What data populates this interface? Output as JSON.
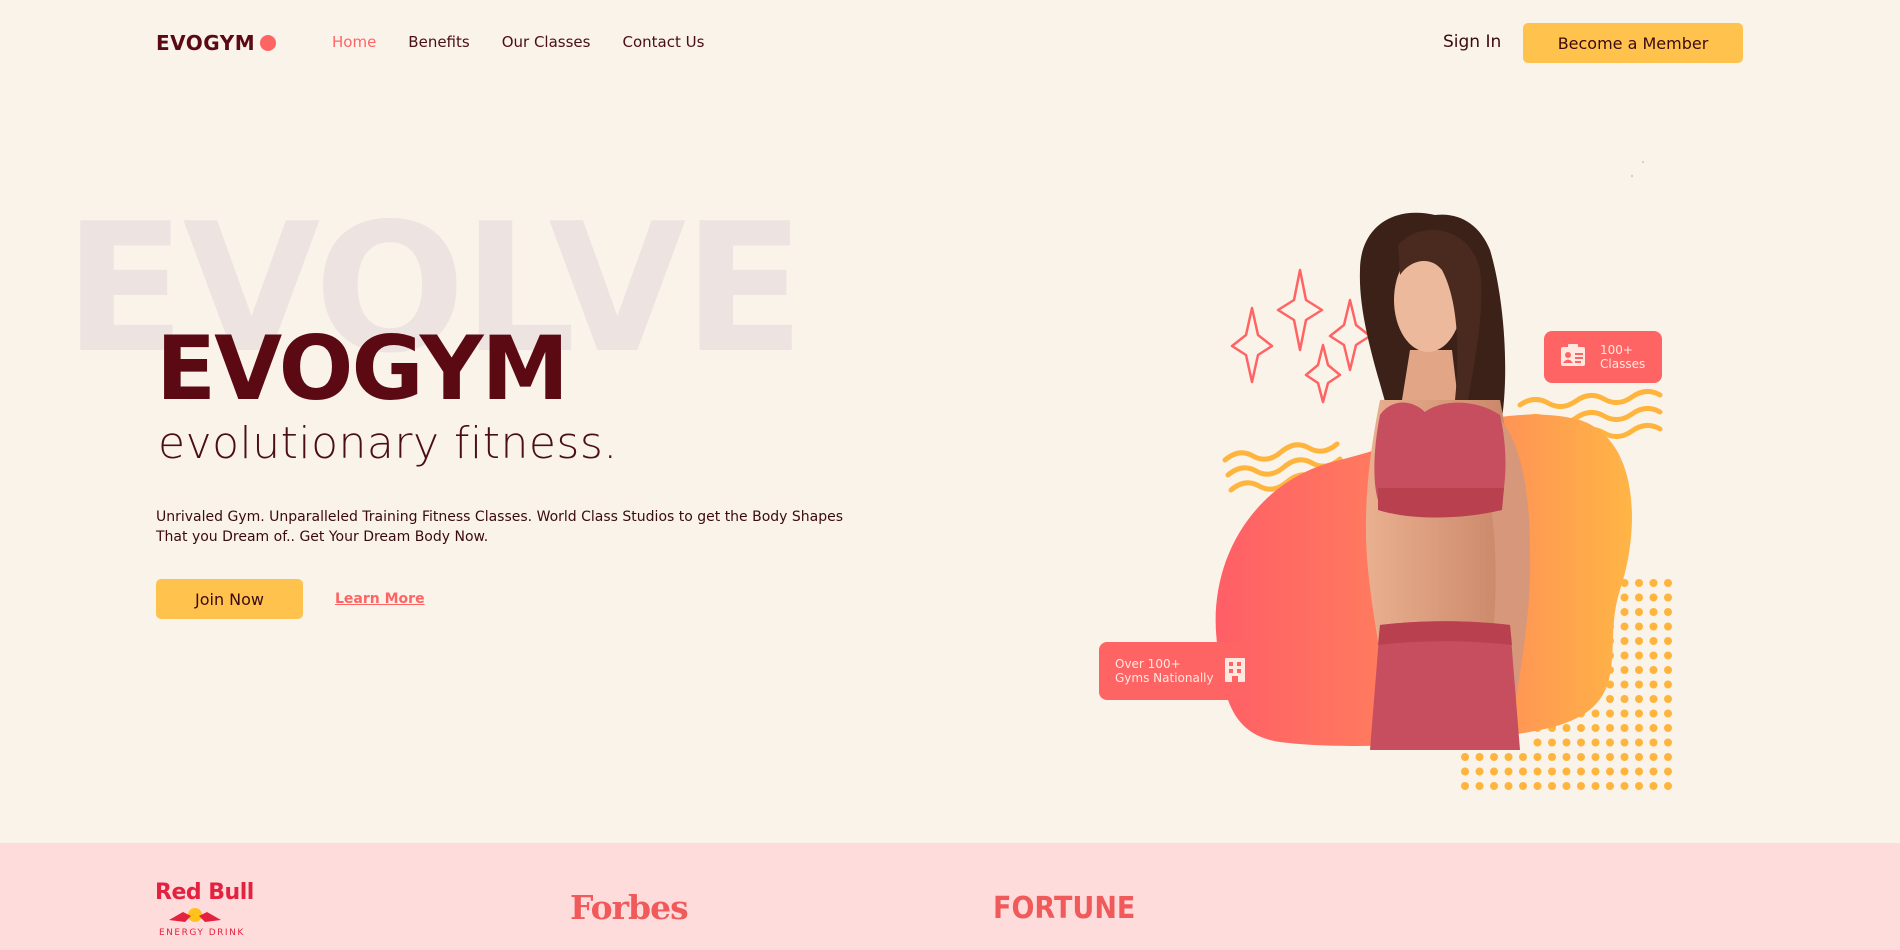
{
  "nav": {
    "logo": "EVOGYM",
    "links": [
      "Home",
      "Benefits",
      "Our Classes",
      "Contact Us"
    ],
    "active_link": "Home",
    "sign_in": "Sign In",
    "member_button": "Become a Member"
  },
  "hero": {
    "background_word": "EVOLVE",
    "title": "EVOGYM",
    "subtitle": "evolutionary fitness.",
    "description": "Unrivaled Gym. Unparalleled Training Fitness Classes. World Class Studios to get the Body Shapes That you Dream of.. Get Your Dream Body Now.",
    "join_button": "Join Now",
    "learn_more": "Learn More",
    "badges": {
      "classes_line1": "100+",
      "classes_line2": "Classes",
      "gyms_line1": "Over 100+",
      "gyms_line2": "Gyms Nationally"
    }
  },
  "sponsors": {
    "redbull": "Red Bull",
    "redbull_sub": "ENERGY DRINK",
    "forbes": "Forbes",
    "fortune": "FORTUNE"
  },
  "colors": {
    "background": "#FAF3EA",
    "primary_dark": "#5B0A13",
    "accent_red": "#FF6464",
    "accent_yellow": "#FFC34D",
    "sponsor_band": "#FFDCDC"
  },
  "icons": [
    "id-card-icon",
    "building-icon",
    "sparkle-icon",
    "wave-decoration",
    "dot-grid-decoration"
  ]
}
